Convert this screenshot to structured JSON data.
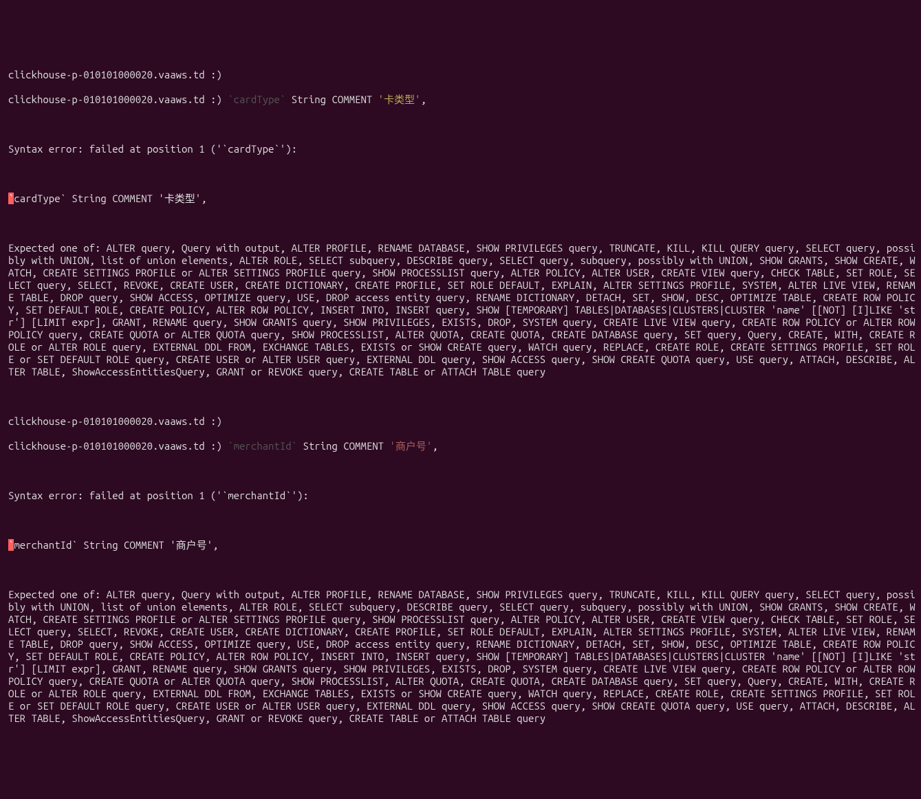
{
  "prompt_host": "clickhouse-p-010101000020.vaaws.td :)",
  "session1": {
    "input_identifier": "`cardType`",
    "input_keywords": "String COMMENT",
    "input_literal": "'卡类型'",
    "input_trailing": ",",
    "syntax_error": "Syntax error: failed at position 1 ('`cardType`'):",
    "echo_hl": "`",
    "echo_rest": "cardType` String COMMENT '卡类型',"
  },
  "session2": {
    "input_identifier": "`merchantId`",
    "input_keywords": "String COMMENT",
    "input_literal": "'商户号'",
    "input_trailing": ",",
    "syntax_error": "Syntax error: failed at position 1 ('`merchantId`'):",
    "echo_hl": "`",
    "echo_rest": "merchantId` String COMMENT '商户号',"
  },
  "expected_message": "Expected one of: ALTER query, Query with output, ALTER PROFILE, RENAME DATABASE, SHOW PRIVILEGES query, TRUNCATE, KILL, KILL QUERY query, SELECT query, possibly with UNION, list of union elements, ALTER ROLE, SELECT subquery, DESCRIBE query, SELECT query, subquery, possibly with UNION, SHOW GRANTS, SHOW CREATE, WATCH, CREATE SETTINGS PROFILE or ALTER SETTINGS PROFILE query, SHOW PROCESSLIST query, ALTER POLICY, ALTER USER, CREATE VIEW query, CHECK TABLE, SET ROLE, SELECT query, SELECT, REVOKE, CREATE USER, CREATE DICTIONARY, CREATE PROFILE, SET ROLE DEFAULT, EXPLAIN, ALTER SETTINGS PROFILE, SYSTEM, ALTER LIVE VIEW, RENAME TABLE, DROP query, SHOW ACCESS, OPTIMIZE query, USE, DROP access entity query, RENAME DICTIONARY, DETACH, SET, SHOW, DESC, OPTIMIZE TABLE, CREATE ROW POLICY, SET DEFAULT ROLE, CREATE POLICY, ALTER ROW POLICY, INSERT INTO, INSERT query, SHOW [TEMPORARY] TABLES|DATABASES|CLUSTERS|CLUSTER 'name' [[NOT] [I]LIKE 'str'] [LIMIT expr], GRANT, RENAME query, SHOW GRANTS query, SHOW PRIVILEGES, EXISTS, DROP, SYSTEM query, CREATE LIVE VIEW query, CREATE ROW POLICY or ALTER ROW POLICY query, CREATE QUOTA or ALTER QUOTA query, SHOW PROCESSLIST, ALTER QUOTA, CREATE QUOTA, CREATE DATABASE query, SET query, Query, CREATE, WITH, CREATE ROLE or ALTER ROLE query, EXTERNAL DDL FROM, EXCHANGE TABLES, EXISTS or SHOW CREATE query, WATCH query, REPLACE, CREATE ROLE, CREATE SETTINGS PROFILE, SET ROLE or SET DEFAULT ROLE query, CREATE USER or ALTER USER query, EXTERNAL DDL query, SHOW ACCESS query, SHOW CREATE QUOTA query, USE query, ATTACH, DESCRIBE, ALTER TABLE, ShowAccessEntitiesQuery, GRANT or REVOKE query, CREATE TABLE or ATTACH TABLE query"
}
